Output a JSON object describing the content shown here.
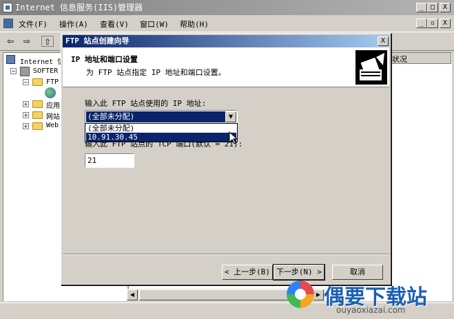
{
  "window": {
    "title": "Internet 信息服务(IIS)管理器",
    "minimize": "_",
    "maximize": "□",
    "close": "X"
  },
  "menu": {
    "items": [
      "文件(F)",
      "操作(A)",
      "查看(V)",
      "窗口(W)",
      "帮助(H)"
    ]
  },
  "tree": {
    "root": "Internet 信",
    "server": "SOFTER",
    "ftp": "FTP",
    "apps": "应用",
    "web_sites": "网站",
    "web": "Web"
  },
  "list": {
    "status_header": "状况"
  },
  "dialog": {
    "title": "FTP 站点创建向导",
    "close": "X",
    "header_title": "IP 地址和端口设置",
    "header_sub": "为 FTP 站点指定 IP 地址和端口设置。",
    "ip_label": "输入此 FTP 站点使用的 IP 地址:",
    "ip_selected": "(全部未分配)",
    "ip_options": [
      "(全部未分配)",
      "10.91.30.45"
    ],
    "port_label": "输入此 FTP 站点的 TCP 端口(默认 = 21):",
    "port_value": "21",
    "back_button": "< 上一步(B)",
    "next_button": "下一步(N) >",
    "cancel_button": "取消"
  },
  "watermark": {
    "brand": "偶要下载站",
    "url": "ouyaoxiazai.com"
  }
}
